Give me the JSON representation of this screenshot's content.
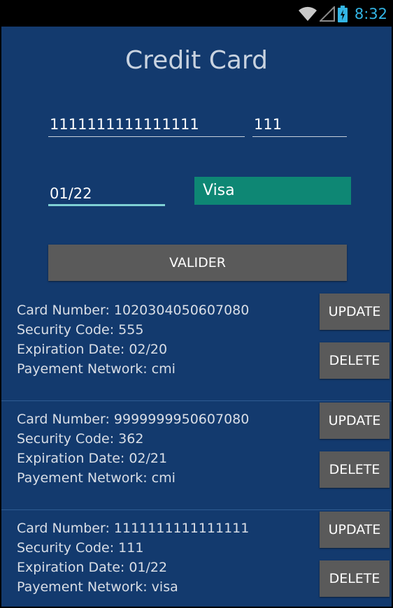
{
  "statusbar": {
    "time": "8:32",
    "icons": [
      "wifi-icon",
      "signal-icon",
      "battery-charging-icon"
    ]
  },
  "title": "Credit Card",
  "form": {
    "card_number": "1111111111111111",
    "security_code": "111",
    "expiration_date": "01/22",
    "network_selected": "Visa",
    "submit_label": "VALIDER"
  },
  "cards": [
    {
      "number": "Card Number: 1020304050607080",
      "code": "Security Code: 555",
      "expiry": "Expiration Date: 02/20",
      "network": "Payement Network: cmi",
      "update_label": "UPDATE",
      "delete_label": "DELETE"
    },
    {
      "number": "Card Number: 9999999950607080",
      "code": "Security Code: 362",
      "expiry": "Expiration Date: 02/21",
      "network": "Payement Network: cmi",
      "update_label": "UPDATE",
      "delete_label": "DELETE"
    },
    {
      "number": "Card Number: 1111111111111111",
      "code": "Security Code: 111",
      "expiry": "Expiration Date: 01/22",
      "network": "Payement Network: visa",
      "update_label": "UPDATE",
      "delete_label": "DELETE"
    }
  ],
  "colors": {
    "background": "#133a6e",
    "accent": "#0e8774",
    "button": "#5a5a5a",
    "clock": "#33b5e5"
  }
}
